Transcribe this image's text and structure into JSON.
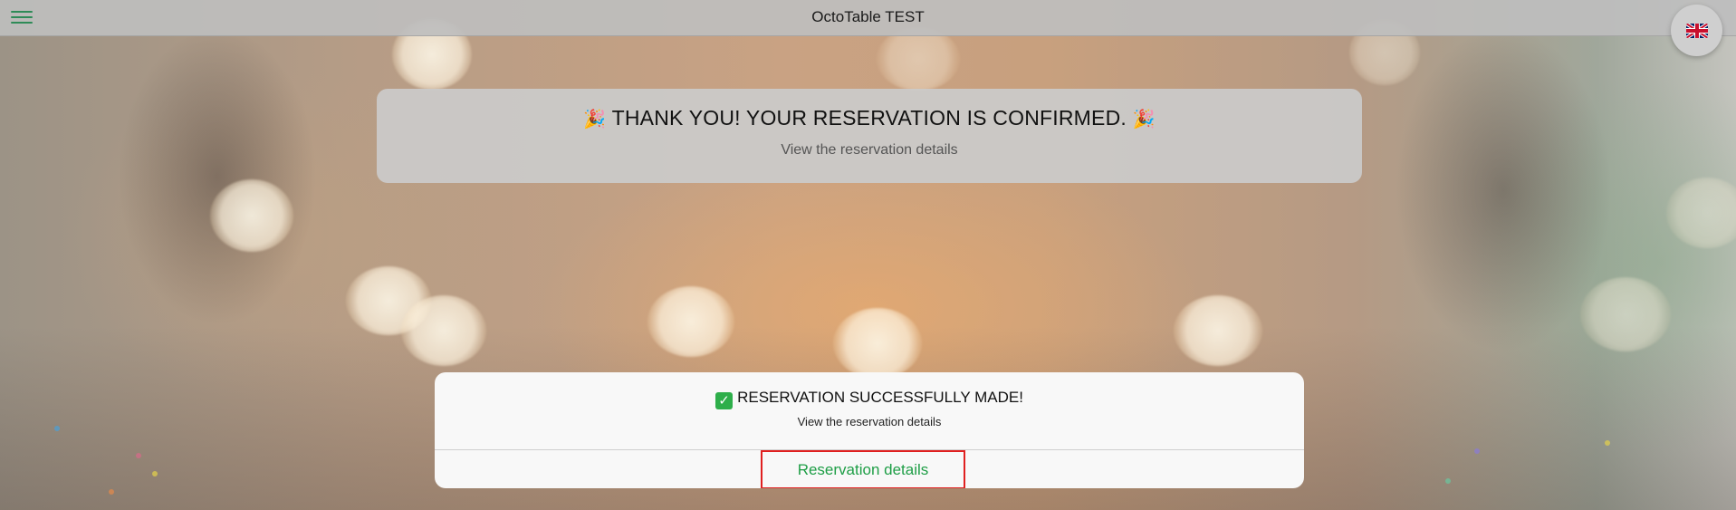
{
  "app": {
    "title": "OctoTable TEST"
  },
  "header": {
    "menu_icon": "hamburger-menu-icon",
    "language_icon": "uk-flag-icon"
  },
  "thanks_card": {
    "emoji": "🎉",
    "title": "THANK YOU! YOUR RESERVATION IS CONFIRMED.",
    "subtitle": "View the reservation details"
  },
  "success_card": {
    "check_icon": "✓",
    "title": "RESERVATION SUCCESSFULLY MADE!",
    "subtitle": "View the reservation details",
    "button_label": "Reservation details"
  },
  "colors": {
    "accent_green": "#1e9e46",
    "highlight_red": "#e02020",
    "check_green": "#2eae4a"
  }
}
